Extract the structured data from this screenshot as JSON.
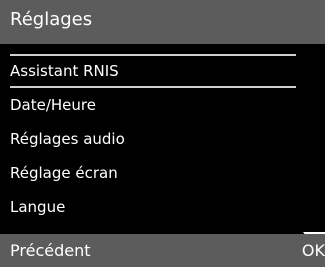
{
  "header": {
    "title": "Réglages"
  },
  "menu": {
    "items": [
      {
        "label": "Assistant RNIS",
        "selected": true
      },
      {
        "label": "Date/Heure"
      },
      {
        "label": "Réglages audio"
      },
      {
        "label": "Réglage écran"
      },
      {
        "label": "Langue"
      }
    ],
    "more_indicator": "chevron-down-icon"
  },
  "softkeys": {
    "left_label": "Précédent",
    "right_label": "OK"
  },
  "colors": {
    "background": "#000000",
    "bar": "#5c5c5c",
    "text": "#ffffff",
    "selection_line": "#cfcfcf"
  }
}
